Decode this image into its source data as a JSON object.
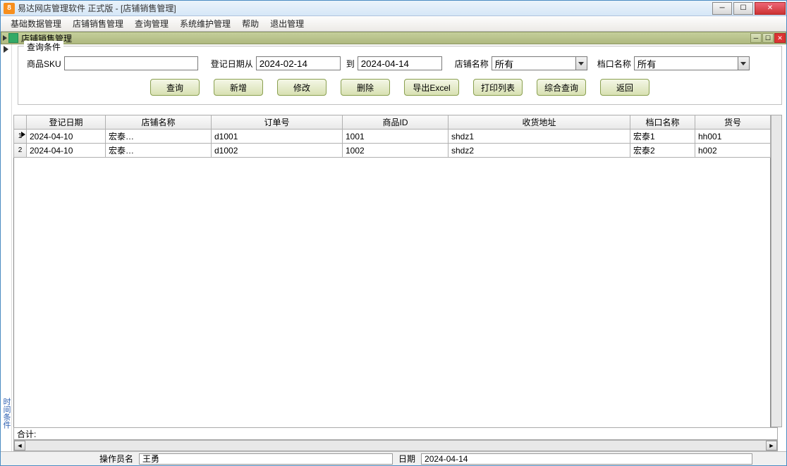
{
  "window": {
    "title": "易达网店管理软件  正式版   -  [店铺销售管理]",
    "icon_glyph": "8"
  },
  "menu": [
    "基础数据管理",
    "店铺销售管理",
    "查询管理",
    "系统维护管理",
    "帮助",
    "退出管理"
  ],
  "mdi": {
    "title": "店铺销售管理"
  },
  "query": {
    "legend": "查询条件",
    "sku_label": "商品SKU",
    "sku_value": "",
    "date_from_label": "登记日期从",
    "date_from": "2024-02-14",
    "date_to_label": "到",
    "date_to": "2024-04-14",
    "store_label": "店铺名称",
    "store_value": "所有",
    "stall_label": "档口名称",
    "stall_value": "所有"
  },
  "buttons": {
    "query": "查询",
    "add": "新增",
    "edit": "修改",
    "delete": "删除",
    "export": "导出Excel",
    "print": "打印列表",
    "advanced": "综合查询",
    "back": "返回"
  },
  "grid": {
    "headers": [
      "登记日期",
      "店铺名称",
      "订单号",
      "商品ID",
      "收货地址",
      "档口名称",
      "货号"
    ],
    "rows": [
      {
        "n": "1",
        "reg_date": "2024-04-10",
        "store": "宏泰…",
        "order": "d1001",
        "pid": "1001",
        "addr": "shdz1",
        "stall": "宏泰1",
        "sku": "hh001"
      },
      {
        "n": "2",
        "reg_date": "2024-04-10",
        "store": "宏泰…",
        "order": "d1002",
        "pid": "1002",
        "addr": "shdz2",
        "stall": "宏泰2",
        "sku": "h002"
      }
    ],
    "summary_label": "合计:"
  },
  "status": {
    "operator_label": "操作员名",
    "operator_value": "王勇",
    "date_label": "日期",
    "date_value": "2024-04-14"
  },
  "side_text": "时间条件"
}
